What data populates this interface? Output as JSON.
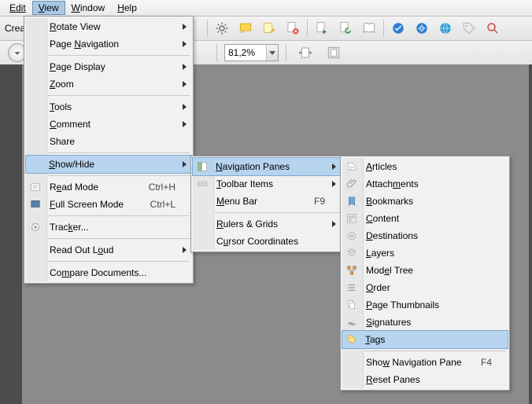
{
  "menubar": {
    "edit": "Edit",
    "view": "View",
    "window": "Window",
    "help": "Help"
  },
  "toolbar": {
    "crea": "Crea",
    "zoom_value": "81,2%"
  },
  "view_menu": {
    "rotate": "Rotate View",
    "pagenav": "Page Navigation",
    "pagedisp": "Page Display",
    "zoom": "Zoom",
    "tools": "Tools",
    "comment": "Comment",
    "share": "Share",
    "showhide": "Show/Hide",
    "readmode": "Read Mode",
    "readmode_k": "Ctrl+H",
    "fullscreen": "Full Screen Mode",
    "fullscreen_k": "Ctrl+L",
    "tracker": "Tracker...",
    "readout": "Read Out Loud",
    "compare": "Compare Documents..."
  },
  "sh_menu": {
    "navpanes": "Navigation Panes",
    "toolbaritems": "Toolbar Items",
    "menubar": "Menu Bar",
    "menubar_k": "F9",
    "rulers": "Rulers & Grids",
    "cursor": "Cursor Coordinates"
  },
  "np_menu": {
    "articles": "Articles",
    "attachments": "Attachments",
    "bookmarks": "Bookmarks",
    "content": "Content",
    "destinations": "Destinations",
    "layers": "Layers",
    "modeltree": "Model Tree",
    "order": "Order",
    "thumbs": "Page Thumbnails",
    "signatures": "Signatures",
    "tags": "Tags",
    "shownav": "Show Navigation Pane",
    "shownav_k": "F4",
    "reset": "Reset Panes"
  }
}
